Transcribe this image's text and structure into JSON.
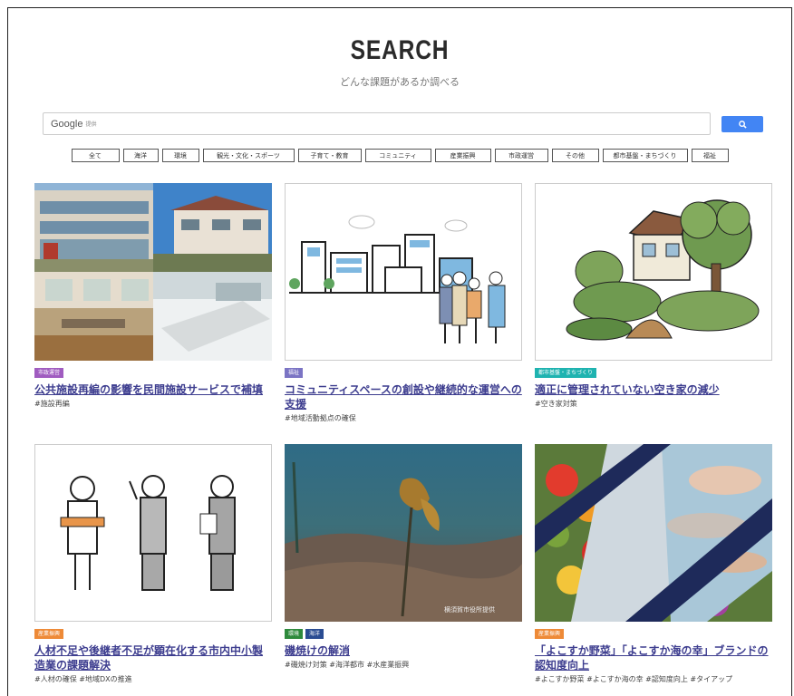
{
  "header": {
    "title": "SEARCH",
    "subtitle": "どんな課題があるか調べる"
  },
  "search": {
    "brand": "Google",
    "brand_suffix": "提供",
    "value": "",
    "placeholder": ""
  },
  "categories": [
    "全て",
    "海洋",
    "環境",
    "観光・文化・スポーツ",
    "子育て・教育",
    "コミュニティ",
    "産業振興",
    "市政運営",
    "その他",
    "都市基盤・まちづくり",
    "福祉"
  ],
  "colors": {
    "search_button": "#4285f4",
    "tag_shisei": "#a05cc0",
    "tag_fukushi": "#7b74c4",
    "tag_toshi": "#1fb3b0",
    "tag_sangyo": "#ee8a37",
    "tag_kankyo": "#2e8a3c",
    "tag_kaiyo": "#2a4c92",
    "link": "#3d3d8f"
  },
  "cards": [
    {
      "tags": [
        "市政運営"
      ],
      "title": "公共施設再編の影響を民間施設サービスで補填",
      "hashtags": "#施設再編",
      "image": "building-photo"
    },
    {
      "tags": [
        "福祉"
      ],
      "title": "コミュニティスペースの創設や継続的な運営への支援",
      "hashtags": "#地域活動拠点の確保",
      "image": "city-people-illustration"
    },
    {
      "tags": [
        "都市基盤・まちづくり"
      ],
      "title": "適正に管理されていない空き家の減少",
      "hashtags": "#空き家対策",
      "image": "overgrown-house-illustration"
    },
    {
      "tags": [
        "産業振興"
      ],
      "title": "人材不足や後継者不足が顕在化する市内中小製造業の課題解決",
      "hashtags": "#人材の確保 #地域DXの推進",
      "image": "workers-illustration"
    },
    {
      "tags": [
        "環境",
        "海洋"
      ],
      "title": "磯焼けの解消",
      "hashtags": "#磯焼け対策 #海洋都市 #水産業振興",
      "image": "underwater-photo",
      "image_caption": "横須賀市役所提供"
    },
    {
      "tags": [
        "産業振興"
      ],
      "title": "「よこすか野菜」「よこすか海の幸」ブランドの認知度向上",
      "hashtags": "#よこすか野菜 #よこすか海の幸 #認知度向上 #タイアップ",
      "image": "vegetables-fish-photo"
    }
  ]
}
